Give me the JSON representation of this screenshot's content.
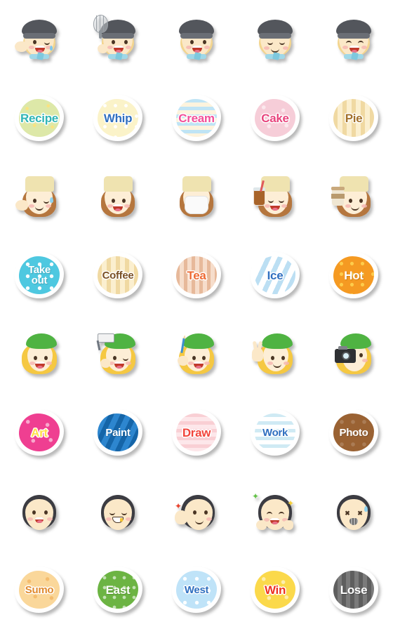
{
  "page": {
    "title": "Emoji sticker grid",
    "background": "#ffffff",
    "columns": 5,
    "rows": 8
  },
  "rows": [
    {
      "kind": "face",
      "character": "chef-boy",
      "items": [
        {
          "name": "chef-wink-wave",
          "expression": "wink-open-mouth",
          "prop": "waving-hand"
        },
        {
          "name": "chef-whisk",
          "expression": "open-mouth",
          "prop": "whisk"
        },
        {
          "name": "chef-smile",
          "expression": "open-mouth",
          "prop": "none"
        },
        {
          "name": "chef-happy-closed-eyes",
          "expression": "closed-eyes-smile",
          "prop": "none"
        },
        {
          "name": "chef-sleepy",
          "expression": "closed-eyes-open-mouth",
          "prop": "none"
        }
      ]
    },
    {
      "kind": "badge",
      "items": [
        {
          "name": "badge-recipe",
          "label": "Recipe",
          "fill": "#dde8a8",
          "text": "#2fb5b5",
          "pattern": "pat-sparkle",
          "lines": 1
        },
        {
          "name": "badge-whip",
          "label": "Whip",
          "fill": "#fbf3c9",
          "text": "#2f6fc0",
          "pattern": "pat-dots-w",
          "lines": 1
        },
        {
          "name": "badge-cream",
          "label": "Cream",
          "fill": "#fdf3dd",
          "text": "#f2509a",
          "pattern": "pat-hstripe-blue",
          "lines": 1
        },
        {
          "name": "badge-cake",
          "label": "Cake",
          "fill": "#f6cdd8",
          "text": "#e8447d",
          "pattern": "pat-stars",
          "lines": 1
        },
        {
          "name": "badge-pie",
          "label": "Pie",
          "fill": "#fbefcf",
          "text": "#a3712c",
          "pattern": "pat-vstripe-cream",
          "lines": 1
        }
      ]
    },
    {
      "kind": "face",
      "character": "barista-girl",
      "items": [
        {
          "name": "barista-wink-wave",
          "expression": "wink-smile",
          "prop": "waving-hand"
        },
        {
          "name": "barista-happy",
          "expression": "open-mouth",
          "prop": "none"
        },
        {
          "name": "barista-mask",
          "expression": "face-mask",
          "prop": "mask"
        },
        {
          "name": "barista-iced-drink",
          "expression": "closed-eyes-open-mouth",
          "prop": "iced-drink-cup"
        },
        {
          "name": "barista-coffee-cup",
          "expression": "smile",
          "prop": "coffee-cup"
        }
      ]
    },
    {
      "kind": "badge",
      "items": [
        {
          "name": "badge-take-out",
          "label": "Take\nout",
          "fill": "#4ec8e0",
          "text": "#ffffff",
          "pattern": "pat-dots-w2",
          "lines": 2
        },
        {
          "name": "badge-coffee",
          "label": "Coffee",
          "fill": "#fbeec0",
          "text": "#7a5024",
          "pattern": "pat-vstripe-cream",
          "lines": 1
        },
        {
          "name": "badge-tea",
          "label": "Tea",
          "fill": "#f6ddcb",
          "text": "#ee6a33",
          "pattern": "pat-vstripe-tea",
          "lines": 1
        },
        {
          "name": "badge-ice",
          "label": "Ice",
          "fill": "#ffffff",
          "text": "#2f6fc0",
          "pattern": "pat-dstripe-ice",
          "lines": 1
        },
        {
          "name": "badge-hot",
          "label": "Hot",
          "fill": "#f59a22",
          "text": "#ffffff",
          "pattern": "pat-dots-o",
          "lines": 1
        }
      ]
    },
    {
      "kind": "face",
      "character": "artist-girl",
      "items": [
        {
          "name": "artist-smile",
          "expression": "open-mouth",
          "prop": "none"
        },
        {
          "name": "artist-paint-roller",
          "expression": "wink-open-mouth",
          "prop": "paint-roller"
        },
        {
          "name": "artist-pen",
          "expression": "open-mouth",
          "prop": "pen"
        },
        {
          "name": "artist-peace-sign",
          "expression": "smile",
          "prop": "peace-sign-flower"
        },
        {
          "name": "artist-camera",
          "expression": "smile",
          "prop": "camera"
        }
      ]
    },
    {
      "kind": "badge",
      "items": [
        {
          "name": "badge-art",
          "label": "Art",
          "fill": "#ef3f91",
          "text": "#ffe04a",
          "pattern": "pat-stars",
          "lines": 1
        },
        {
          "name": "badge-paint",
          "label": "Paint",
          "fill": "#2d86cf",
          "text": "#ffffff",
          "pattern": "pat-dstripe-blue",
          "lines": 1
        },
        {
          "name": "badge-draw",
          "label": "Draw",
          "fill": "#fde7ea",
          "text": "#f2453c",
          "pattern": "pat-hstripe-pink",
          "lines": 1
        },
        {
          "name": "badge-work",
          "label": "Work",
          "fill": "#ffffff",
          "text": "#2f6fc0",
          "pattern": "pat-hstripe-ltblue",
          "lines": 1
        },
        {
          "name": "badge-photo",
          "label": "Photo",
          "fill": "#9a6233",
          "text": "#ffffff",
          "pattern": "pat-dots-brown",
          "lines": 1
        }
      ]
    },
    {
      "kind": "face",
      "character": "sumo-wrestler",
      "items": [
        {
          "name": "sumo-smile",
          "expression": "open-mouth",
          "prop": "none"
        },
        {
          "name": "sumo-grin-gold-tooth",
          "expression": "closed-eyes-grin",
          "prop": "gold-tooth"
        },
        {
          "name": "sumo-thumbs-up",
          "expression": "smile",
          "prop": "raised-hand-star"
        },
        {
          "name": "sumo-excited-stars",
          "expression": "closed-eyes-open-mouth",
          "prop": "hands-on-cheeks-stars"
        },
        {
          "name": "sumo-knocked-out",
          "expression": "x-eyes-dizzy",
          "prop": "sweat-drop"
        }
      ]
    },
    {
      "kind": "badge",
      "items": [
        {
          "name": "badge-sumo",
          "label": "Sumo",
          "fill": "#fad79a",
          "text": "#e08a2e",
          "pattern": "pat-sumo",
          "lines": 1
        },
        {
          "name": "badge-east",
          "label": "East",
          "fill": "#6cb443",
          "text": "#ffffff",
          "pattern": "pat-dots-green",
          "lines": 1
        },
        {
          "name": "badge-west",
          "label": "West",
          "fill": "#bfe3f8",
          "text": "#2f6fc0",
          "pattern": "pat-dots-w2",
          "lines": 1
        },
        {
          "name": "badge-win",
          "label": "Win",
          "fill": "#fbd94b",
          "text": "#ee3322",
          "pattern": "pat-stars",
          "lines": 1
        },
        {
          "name": "badge-lose",
          "label": "Lose",
          "fill": "#6b6b6b",
          "text": "#ffffff",
          "pattern": "pat-vstripe-gray",
          "lines": 1
        }
      ]
    }
  ]
}
